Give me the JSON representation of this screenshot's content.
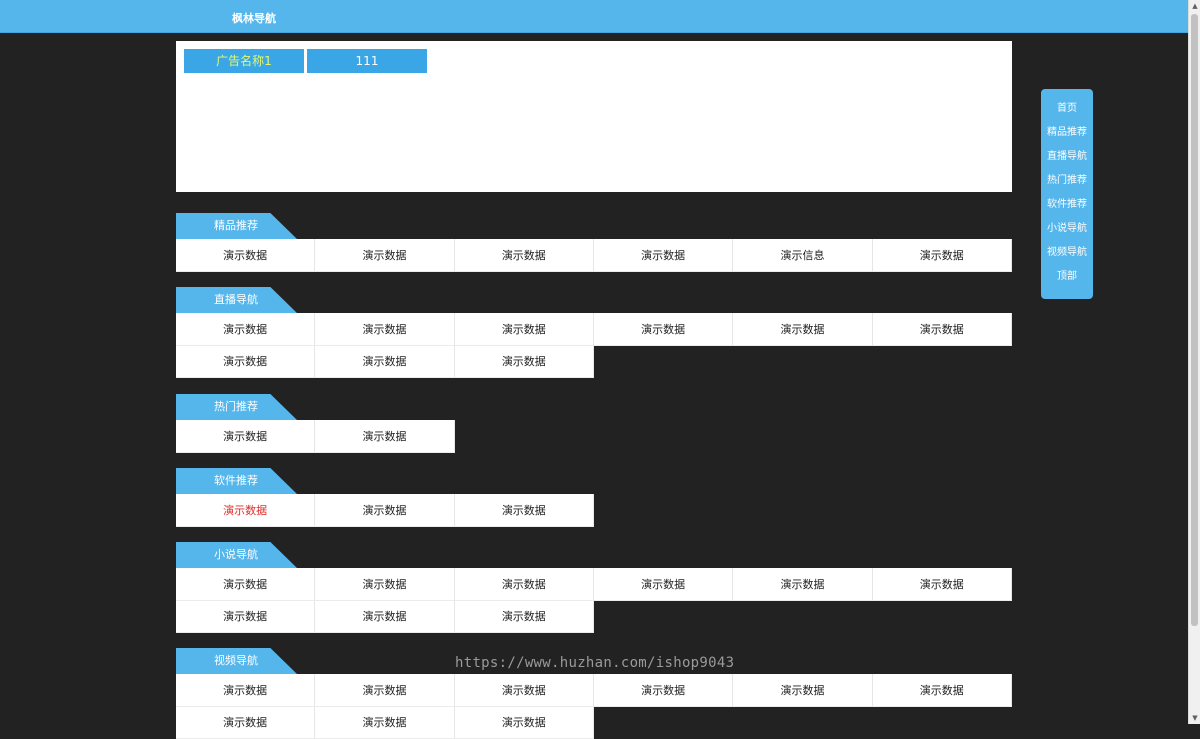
{
  "header": {
    "site_title": "枫林导航"
  },
  "ads": [
    {
      "label": "广告名称1",
      "color": "#e6f76a"
    },
    {
      "label": "111",
      "color": "#ffffff"
    }
  ],
  "sections": [
    {
      "title": "精品推荐",
      "items": [
        "演示数据",
        "演示数据",
        "演示数据",
        "演示数据",
        "演示信息",
        "演示数据"
      ]
    },
    {
      "title": "直播导航",
      "items": [
        "演示数据",
        "演示数据",
        "演示数据",
        "演示数据",
        "演示数据",
        "演示数据",
        "演示数据",
        "演示数据",
        "演示数据"
      ]
    },
    {
      "title": "热门推荐",
      "items": [
        "演示数据",
        "演示数据"
      ]
    },
    {
      "title": "软件推荐",
      "items": [
        "演示数据",
        "演示数据",
        "演示数据"
      ],
      "highlight_index": 0,
      "highlight_color": "#e02b2b"
    },
    {
      "title": "小说导航",
      "items": [
        "演示数据",
        "演示数据",
        "演示数据",
        "演示数据",
        "演示数据",
        "演示数据",
        "演示数据",
        "演示数据",
        "演示数据"
      ]
    },
    {
      "title": "视频导航",
      "items": [
        "演示数据",
        "演示数据",
        "演示数据",
        "演示数据",
        "演示数据",
        "演示数据",
        "演示数据",
        "演示数据",
        "演示数据"
      ]
    }
  ],
  "side_nav": [
    "首页",
    "精品推荐",
    "直播导航",
    "热门推荐",
    "软件推荐",
    "小说导航",
    "视频导航",
    "顶部"
  ],
  "watermark": "https://www.huzhan.com/ishop9043",
  "colors": {
    "accent": "#55b6ec",
    "background": "#222222",
    "ad_button": "#3aa6e6"
  }
}
